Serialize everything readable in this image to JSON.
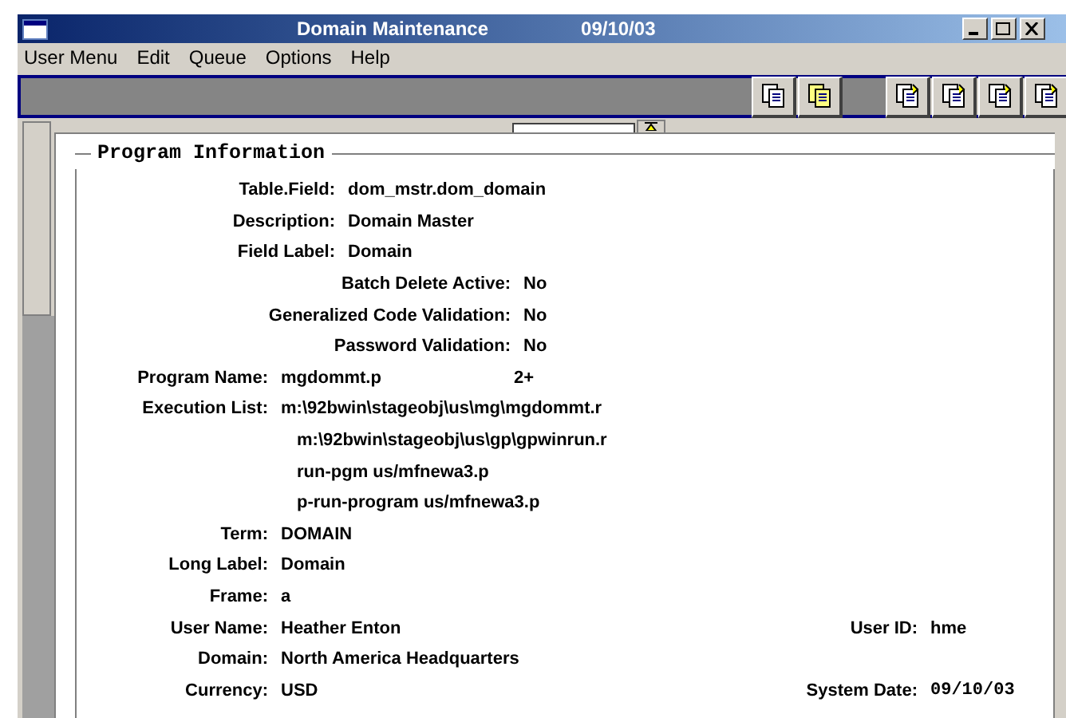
{
  "window": {
    "title": "Domain Maintenance",
    "date": "09/10/03"
  },
  "menu": [
    "User Menu",
    "Edit",
    "Queue",
    "Options",
    "Help"
  ],
  "panel": {
    "title": "Program Information",
    "rows": [
      {
        "kind": "mid",
        "label": "Table.Field:",
        "value": "dom_mstr.dom_domain"
      },
      {
        "kind": "mid",
        "label": "Description:",
        "value": "Domain Master"
      },
      {
        "kind": "mid",
        "label": "Field Label:",
        "value": "Domain"
      },
      {
        "kind": "far",
        "label": "Batch Delete Active:",
        "value": "No"
      },
      {
        "kind": "far",
        "label": "Generalized Code Validation:",
        "value": "No"
      },
      {
        "kind": "far",
        "label": "Password Validation:",
        "value": "No"
      },
      {
        "kind": "near",
        "label": "Program Name:",
        "value": "mgdommt.p",
        "extra": "2+"
      },
      {
        "kind": "near",
        "label": "Execution List:",
        "value": "m:\\92bwin\\stageobj\\us\\mg\\mgdommt.r"
      },
      {
        "kind": "cont",
        "value": "m:\\92bwin\\stageobj\\us\\gp\\gpwinrun.r"
      },
      {
        "kind": "cont",
        "value": "run-pgm us/mfnewa3.p"
      },
      {
        "kind": "cont",
        "value": "p-run-program us/mfnewa3.p"
      },
      {
        "kind": "near",
        "label": "Term:",
        "value": "DOMAIN"
      },
      {
        "kind": "near",
        "label": "Long Label:",
        "value": "Domain"
      },
      {
        "kind": "near",
        "label": "Frame:",
        "value": "a"
      },
      {
        "kind": "near",
        "label": "User Name:",
        "value": "Heather Enton",
        "right_label": "User ID:",
        "right_value": "hme"
      },
      {
        "kind": "near",
        "label": "Domain:",
        "value": "North America Headquarters"
      },
      {
        "kind": "near",
        "label": "Currency:",
        "value": "USD",
        "right_label": "System Date:",
        "right_value": "09/10/03",
        "right_mono": true
      }
    ]
  }
}
